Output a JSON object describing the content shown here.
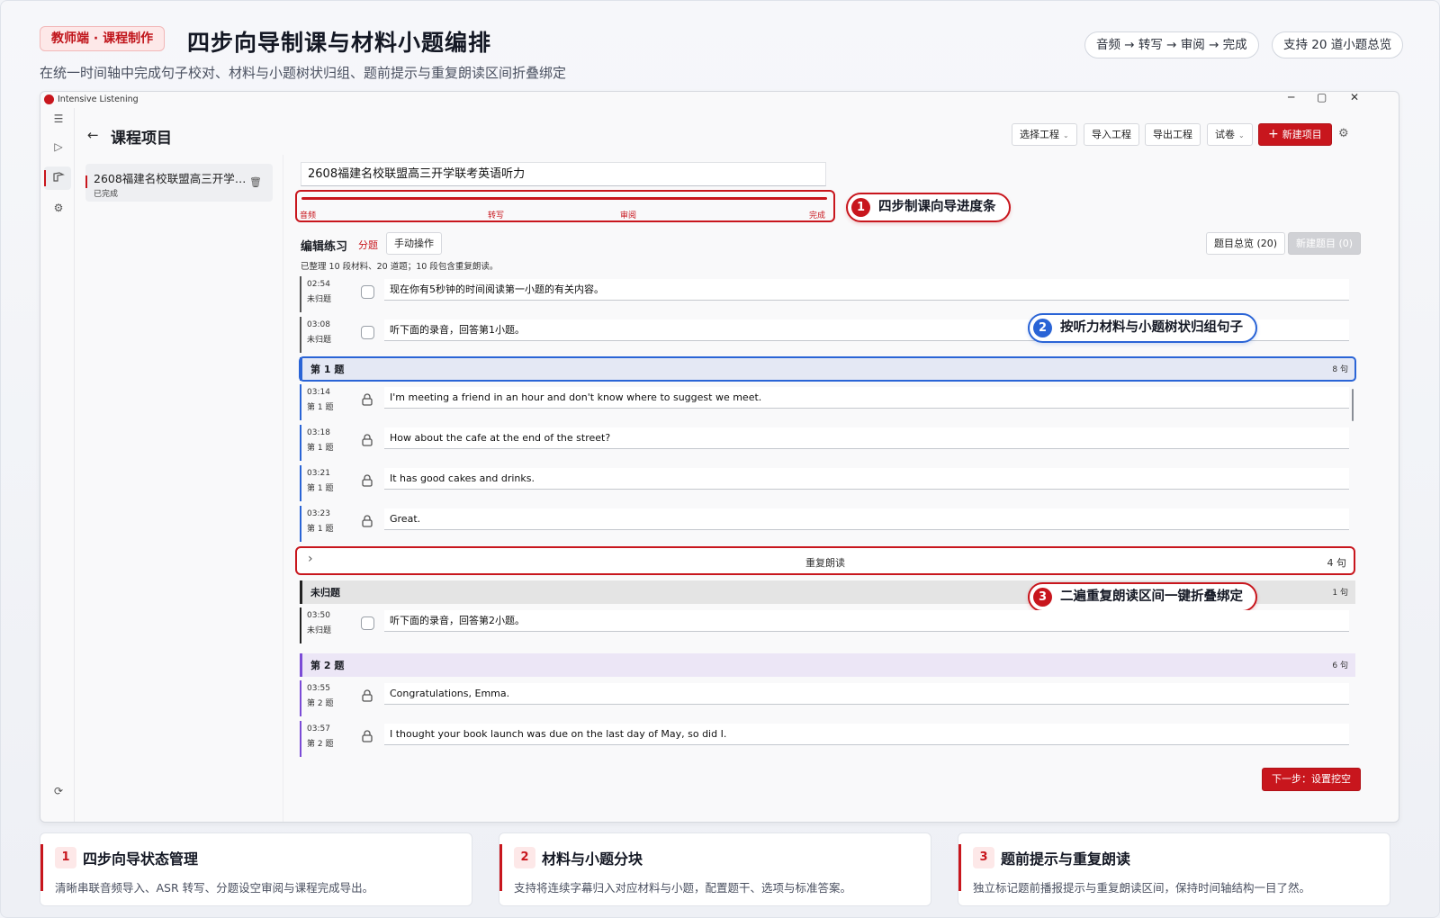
{
  "header": {
    "tag": "教师端 · 课程制作",
    "title": "四步向导制课与材料小题编排",
    "subtitle": "在统一时间轴中完成句子校对、材料与小题树状归组、题前提示与重复朗读区间折叠绑定",
    "pill_flow": "音频 → 转写 → 审阅 → 完成",
    "pill_count": "支持 20 道小题总览"
  },
  "app": {
    "name": "Intensive Listening",
    "window_controls": [
      "─",
      "▢",
      "✕"
    ],
    "page_title": "课程项目",
    "toolbar": {
      "select_project": "选择工程",
      "import_project": "导入工程",
      "export_project": "导出工程",
      "paper": "试卷",
      "new_project": "新建项目"
    },
    "project": {
      "name": "2608福建名校联盟高三开学联考英语听力",
      "status": "已完成"
    },
    "course_name": "2608福建名校联盟高三开学联考英语听力",
    "steps": [
      "音频",
      "转写",
      "审阅",
      "完成"
    ],
    "edit": {
      "title": "编辑练习",
      "split": "分题",
      "manual": "手动操作",
      "overview": "题目总览 (20)",
      "new_question": "新建题目 (0)",
      "summary": "已整理 10 段材料、20 道题；10 段包含重复朗读。"
    },
    "rows_top": [
      {
        "time": "02:54",
        "group": "未归题",
        "text": "现在你有5秒钟的时间阅读第一小题的有关内容。"
      },
      {
        "time": "03:08",
        "group": "未归题",
        "text": "听下面的录音，回答第1小题。"
      }
    ],
    "group1": {
      "title": "第 1 题",
      "count": "8 句"
    },
    "rows_g1": [
      {
        "time": "03:14",
        "group": "第 1 题",
        "text": "I'm meeting a friend in an hour and don't know where to suggest we meet."
      },
      {
        "time": "03:18",
        "group": "第 1 题",
        "text": "How about the cafe at the end of the street?"
      },
      {
        "time": "03:21",
        "group": "第 1 题",
        "text": "It has good cakes and drinks."
      },
      {
        "time": "03:23",
        "group": "第 1 题",
        "text": "Great."
      }
    ],
    "repeat": {
      "label": "重复朗读",
      "count": "4 句"
    },
    "group_unassigned": {
      "title": "未归题",
      "count": "1 句"
    },
    "rows_un": [
      {
        "time": "03:50",
        "group": "未归题",
        "text": "听下面的录音，回答第2小题。"
      }
    ],
    "group2": {
      "title": "第 2 题",
      "count": "6 句"
    },
    "rows_g2": [
      {
        "time": "03:55",
        "group": "第 2 题",
        "text": "Congratulations, Emma."
      },
      {
        "time": "03:57",
        "group": "第 2 题",
        "text": "I thought your book launch was due on the last day of May, so did I."
      }
    ],
    "next_button": "下一步：设置挖空"
  },
  "callouts": [
    {
      "num": "1",
      "text": "四步制课向导进度条"
    },
    {
      "num": "2",
      "text": "按听力材料与小题树状归组句子"
    },
    {
      "num": "3",
      "text": "二遍重复朗读区间一键折叠绑定"
    }
  ],
  "features": [
    {
      "num": "1",
      "title": "四步向导状态管理",
      "desc": "清晰串联音频导入、ASR 转写、分题设空审阅与课程完成导出。"
    },
    {
      "num": "2",
      "title": "材料与小题分块",
      "desc": "支持将连续字幕归入对应材料与小题，配置题干、选项与标准答案。"
    },
    {
      "num": "3",
      "title": "题前提示与重复朗读",
      "desc": "独立标记题前播报提示与重复朗读区间，保持时间轴结构一目了然。"
    }
  ],
  "colors": {
    "accent": "#c8161d",
    "blue": "#2a64d6",
    "group1_bg": "#e4e8f4",
    "group2_bg": "#ece6f6",
    "group2_bar": "#7b4bd6",
    "unassigned_bg": "#e4e4e4"
  }
}
